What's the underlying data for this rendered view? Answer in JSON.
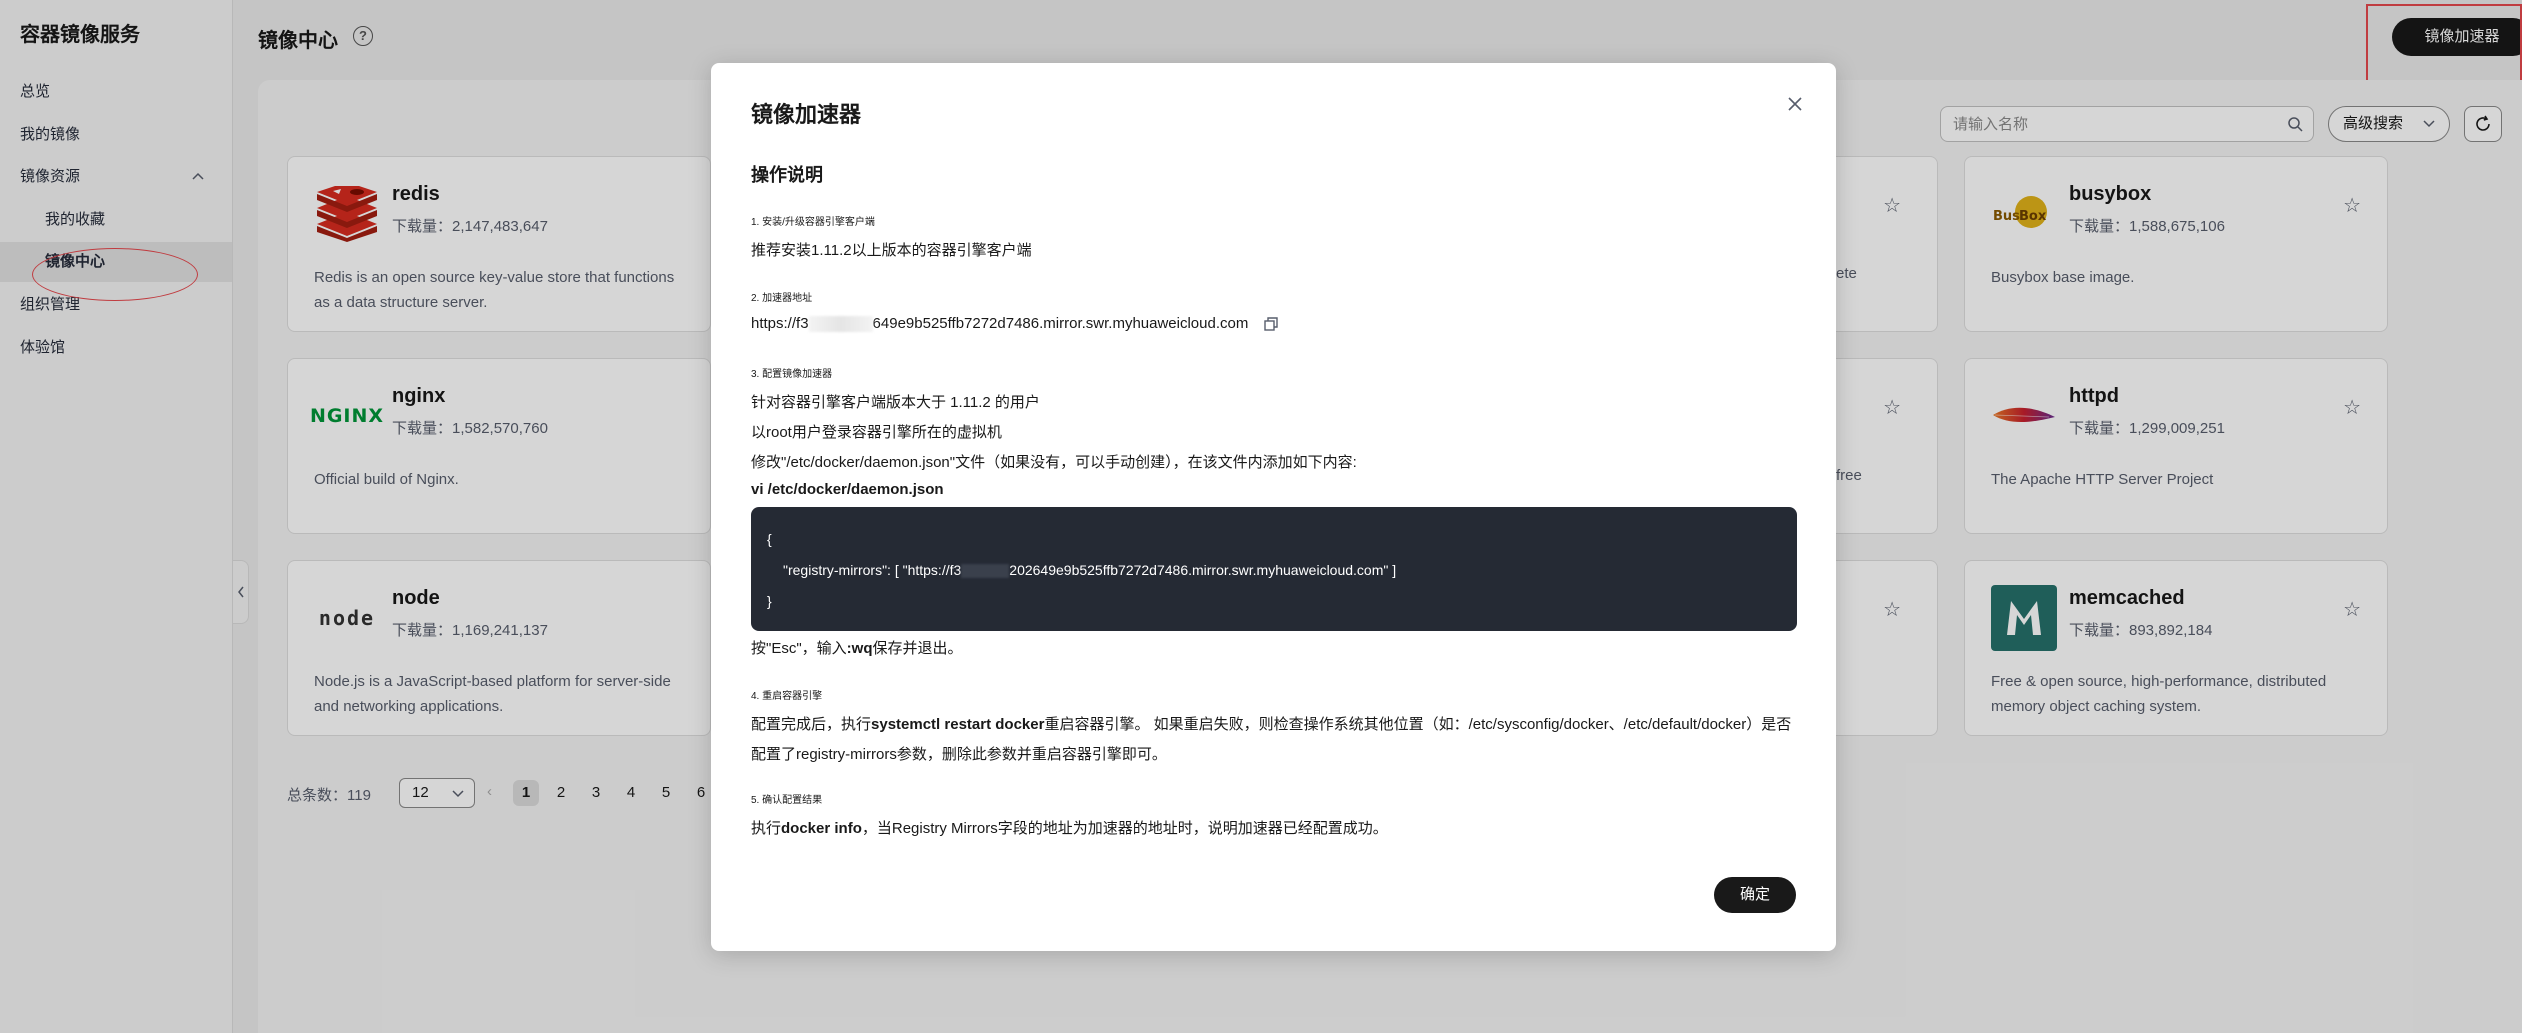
{
  "sidebar": {
    "title": "容器镜像服务",
    "items": [
      {
        "label": "总览"
      },
      {
        "label": "我的镜像"
      },
      {
        "label": "镜像资源"
      },
      {
        "label": "我的收藏"
      },
      {
        "label": "镜像中心"
      },
      {
        "label": "组织管理"
      },
      {
        "label": "体验馆"
      }
    ]
  },
  "header": {
    "title": "镜像中心",
    "help_glyph": "?",
    "accelerator_button": "镜像加速器"
  },
  "toolbar": {
    "search_placeholder": "请输入名称",
    "advanced_search": "高级搜索"
  },
  "cards": [
    {
      "name": "redis",
      "downloads": "下载量：2,147,483,647",
      "description": "Redis is an open source key-value store that functions as a data structure server.",
      "icon": "redis-logo",
      "star": "☆"
    },
    {
      "name": "busybox",
      "downloads": "下载量：1,588,675,106",
      "description": "Busybox base image.",
      "icon": "busybox-logo",
      "star": "☆"
    },
    {
      "name": "nginx",
      "downloads": "下载量：1,582,570,760",
      "description": "Official build of Nginx.",
      "icon": "nginx-logo",
      "logo_text": "NGINX",
      "star": "☆"
    },
    {
      "name": "httpd",
      "downloads": "下载量：1,299,009,251",
      "description": "The Apache HTTP Server Project",
      "icon": "apache-feather-logo",
      "star": "☆"
    },
    {
      "name": "node",
      "downloads": "下载量：1,169,241,137",
      "description": "Node.js is a JavaScript-based platform for server-side and networking applications.",
      "icon": "node-logo",
      "logo_text": "node",
      "star": "☆"
    },
    {
      "name": "memcached",
      "downloads": "下载量：893,892,184",
      "description": "Free & open source, high-performance, distributed memory object caching system.",
      "icon": "memcached-logo",
      "star": "☆"
    }
  ],
  "hidden_card_fragments": [
    "ete",
    "free"
  ],
  "pagination": {
    "total": "总条数：119",
    "page_size": "12",
    "prev": "‹",
    "pages": [
      "1",
      "2",
      "3",
      "4",
      "5",
      "6"
    ],
    "current": "1"
  },
  "modal": {
    "title": "镜像加速器",
    "section_title": "操作说明",
    "step1_title": "1. 安装/升级容器引擎客户端",
    "step1_text": "推荐安装1.11.2以上版本的容器引擎客户端",
    "step2_title": "2. 加速器地址",
    "step2_url_prefix": "https://f3",
    "step2_url_suffix": "649e9b525ffb7272d7486.mirror.swr.myhuaweicloud.com",
    "step3_title": "3. 配置镜像加速器",
    "step3_line1": "针对容器引擎客户端版本大于 1.11.2 的用户",
    "step3_line2": "以root用户登录容器引擎所在的虚拟机",
    "step3_line3": "修改\"/etc/docker/daemon.json\"文件（如果没有，可以手动创建），在该文件内添加如下内容:",
    "step3_cmd": "vi /etc/docker/daemon.json",
    "code": {
      "open": "{",
      "line_prefix": "\"registry-mirrors\": [ \"https://f3",
      "line_suffix": "202649e9b525ffb7272d7486.mirror.swr.myhuaweicloud.com\" ]",
      "close": "}"
    },
    "step3_after_prefix": "按\"Esc\"，输入",
    "step3_after_bold": ":wq",
    "step3_after_suffix": "保存并退出。",
    "step4_title": "4. 重启容器引擎",
    "step4_line1_prefix": "配置完成后，执行",
    "step4_line1_bold": "systemctl restart docker",
    "step4_line1_suffix": "重启容器引擎。 如果重启失败，则检查操作系统其他位置（如：/etc/sysconfig/docker、/etc/default/docker）是否",
    "step4_line2": "配置了registry-mirrors参数，删除此参数并重启容器引擎即可。",
    "step5_title": "5. 确认配置结果",
    "step5_prefix": "执行",
    "step5_bold": "docker info",
    "step5_suffix": "，当Registry Mirrors字段的地址为加速器的地址时，说明加速器已经配置成功。",
    "confirm": "确定"
  },
  "colors": {
    "primary_dark": "#191919",
    "annotation_red": "#e5484d",
    "code_bg": "#252a34",
    "nginx_green": "#009639",
    "redis_red": "#d82c20",
    "node_green": "#539e43",
    "memcached_teal": "#26716b"
  }
}
